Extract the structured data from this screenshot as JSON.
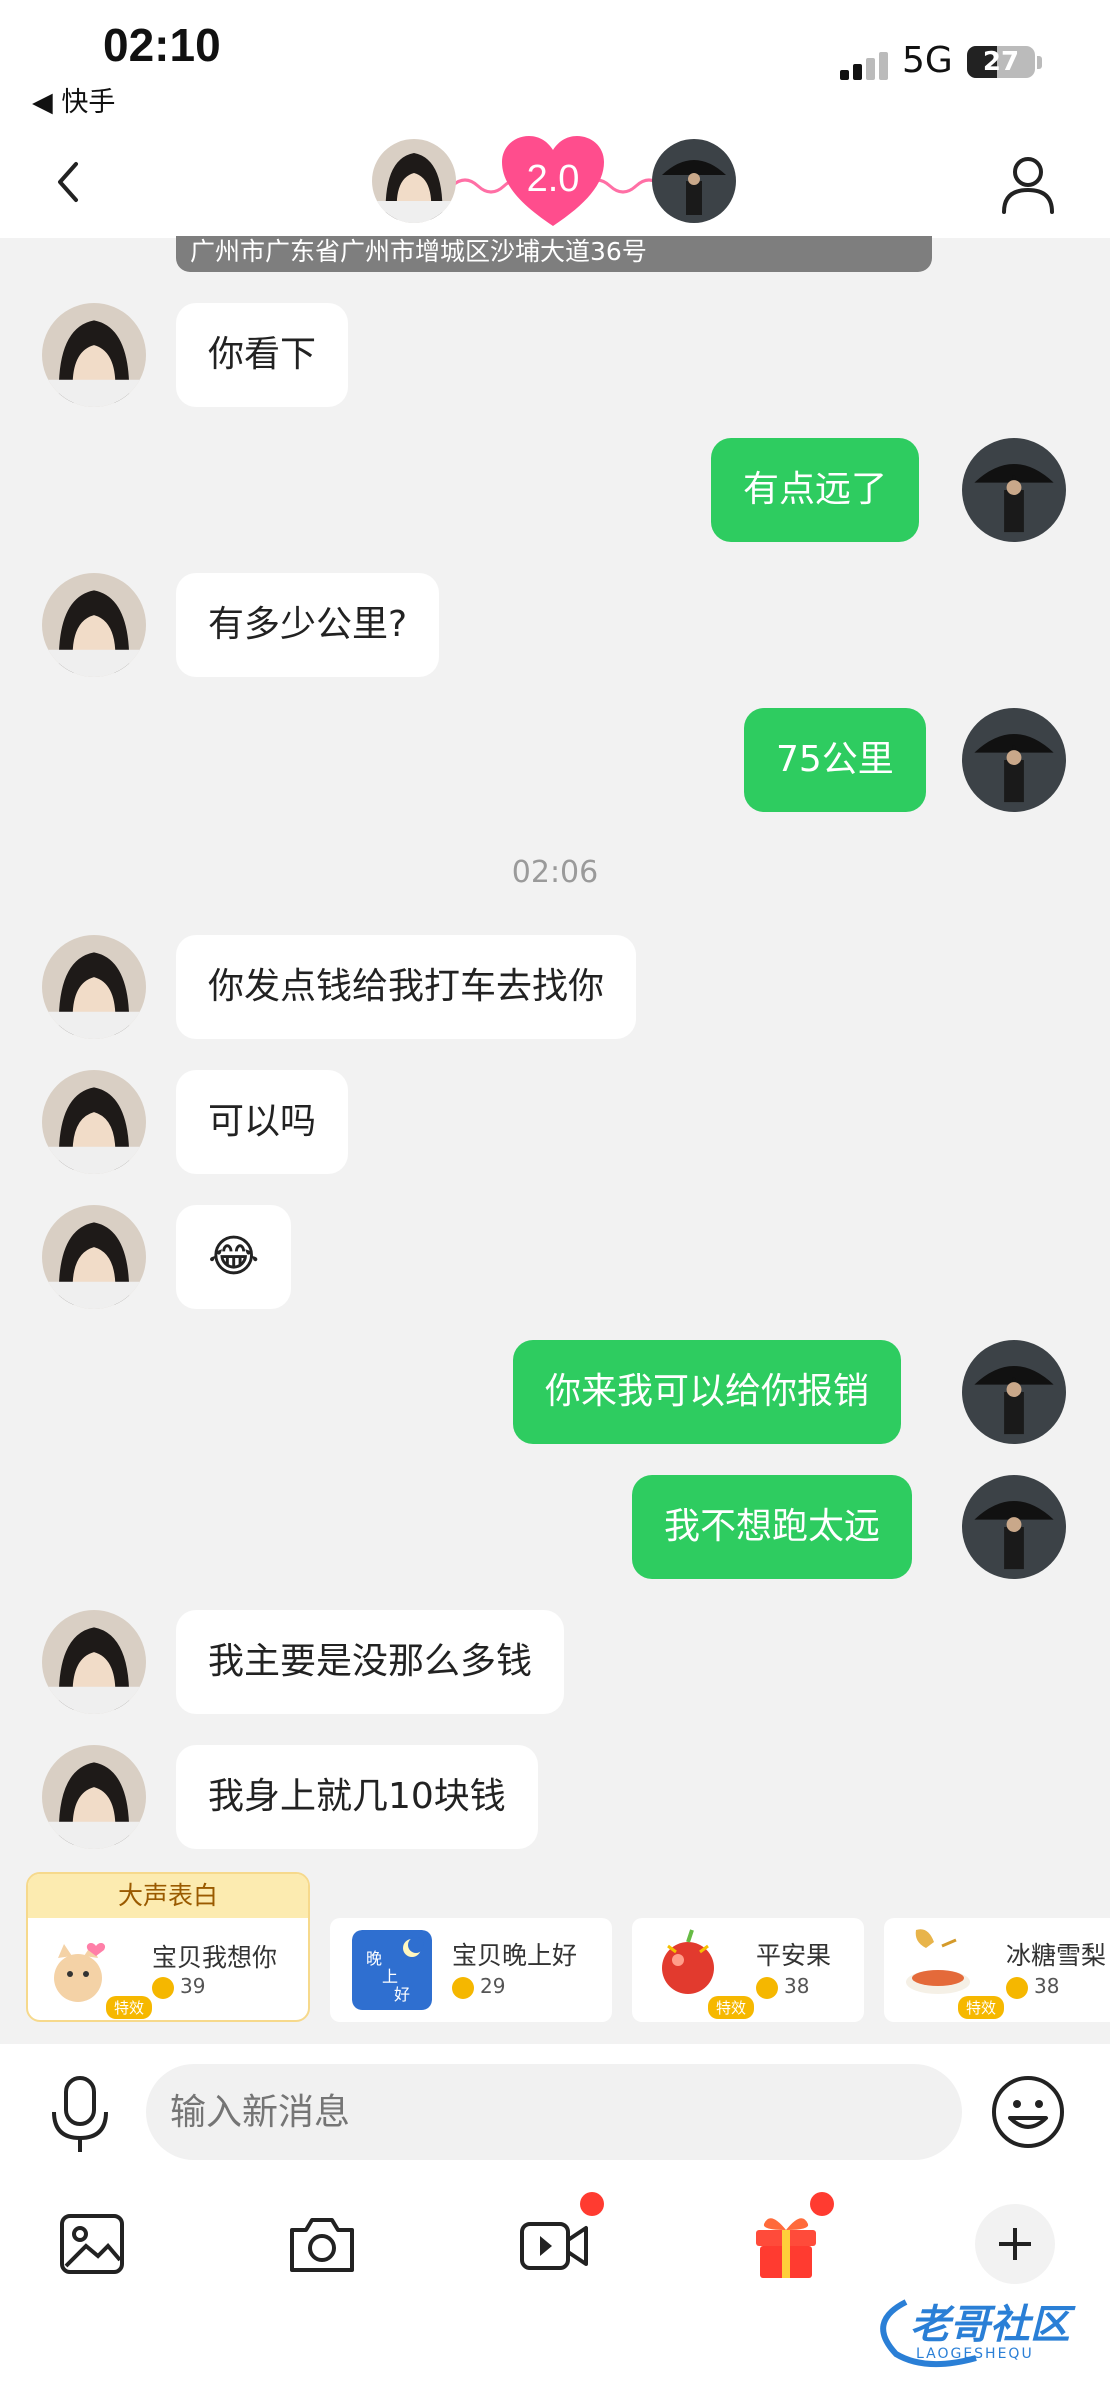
{
  "status_bar": {
    "time": "02:10",
    "back_app": "◀ 快手",
    "network": "5G",
    "battery": "27"
  },
  "header": {
    "intimacy_level": "2.0"
  },
  "map_card": {
    "address": "广州市广东省广州市增城区沙埔大道36号"
  },
  "messages": [
    {
      "from": "them",
      "text": "你看下"
    },
    {
      "from": "me",
      "text": "有点远了"
    },
    {
      "from": "them",
      "text": "有多少公里?"
    },
    {
      "from": "me",
      "text": "75公里"
    },
    {
      "from": "them",
      "text": "你发点钱给我打车去找你"
    },
    {
      "from": "them",
      "text": "可以吗"
    },
    {
      "from": "them",
      "text": "😂"
    },
    {
      "from": "me",
      "text": "你来我可以给你报销"
    },
    {
      "from": "me",
      "text": "我不想跑太远"
    },
    {
      "from": "them",
      "text": "我主要是没那么多钱"
    },
    {
      "from": "them",
      "text": "我身上就几10块钱"
    }
  ],
  "timestamp": "02:06",
  "gifts": {
    "header": "大声表白",
    "items": [
      {
        "name": "宝贝我想你",
        "price": "39",
        "tag": "特效"
      },
      {
        "name": "宝贝晚上好",
        "price": "29",
        "tag": ""
      },
      {
        "name": "平安果",
        "price": "38",
        "tag": "特效"
      },
      {
        "name": "冰糖雪梨",
        "price": "38",
        "tag": "特效"
      }
    ]
  },
  "input": {
    "placeholder": "输入新消息"
  },
  "watermark": {
    "text": "老哥社区",
    "sub": "LAOGESHEQU"
  },
  "colors": {
    "outgoing_bubble": "#2ecc60",
    "incoming_bubble": "#ffffff",
    "background": "#f2f2f2",
    "heart": "#ff4d8d"
  }
}
